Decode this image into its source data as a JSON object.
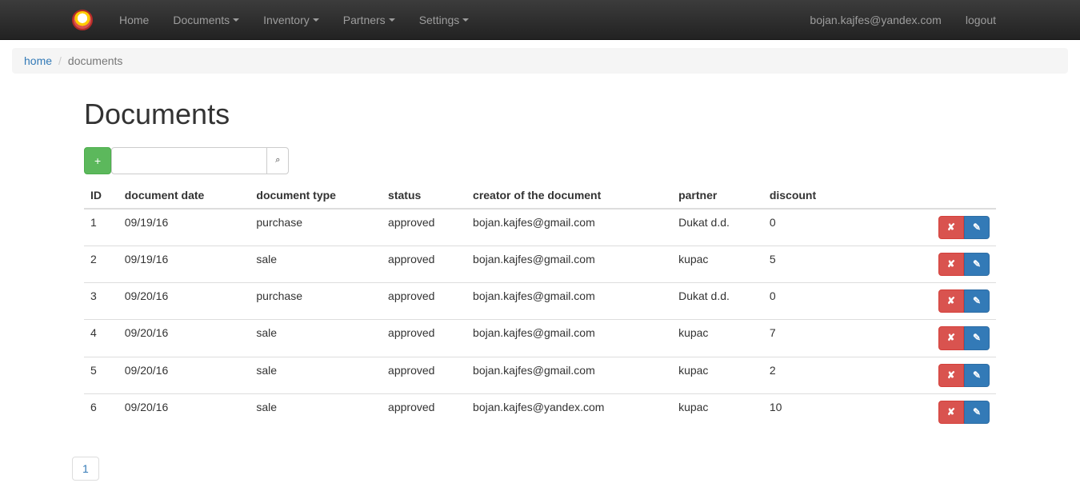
{
  "nav": {
    "home": "Home",
    "documents": "Documents",
    "inventory": "Inventory",
    "partners": "Partners",
    "settings": "Settings",
    "user_email": "bojan.kajfes@yandex.com",
    "logout": "logout"
  },
  "breadcrumb": {
    "home": "home",
    "current": "documents"
  },
  "page": {
    "title": "Documents",
    "add_label": "+",
    "search_value": ""
  },
  "table": {
    "headers": {
      "id": "ID",
      "date": "document date",
      "type": "document type",
      "status": "status",
      "creator": "creator of the document",
      "partner": "partner",
      "discount": "discount"
    },
    "rows": [
      {
        "id": "1",
        "date": "09/19/16",
        "type": "purchase",
        "status": "approved",
        "creator": "bojan.kajfes@gmail.com",
        "partner": "Dukat d.d.",
        "discount": "0"
      },
      {
        "id": "2",
        "date": "09/19/16",
        "type": "sale",
        "status": "approved",
        "creator": "bojan.kajfes@gmail.com",
        "partner": "kupac",
        "discount": "5"
      },
      {
        "id": "3",
        "date": "09/20/16",
        "type": "purchase",
        "status": "approved",
        "creator": "bojan.kajfes@gmail.com",
        "partner": "Dukat d.d.",
        "discount": "0"
      },
      {
        "id": "4",
        "date": "09/20/16",
        "type": "sale",
        "status": "approved",
        "creator": "bojan.kajfes@gmail.com",
        "partner": "kupac",
        "discount": "7"
      },
      {
        "id": "5",
        "date": "09/20/16",
        "type": "sale",
        "status": "approved",
        "creator": "bojan.kajfes@gmail.com",
        "partner": "kupac",
        "discount": "2"
      },
      {
        "id": "6",
        "date": "09/20/16",
        "type": "sale",
        "status": "approved",
        "creator": "bojan.kajfes@yandex.com",
        "partner": "kupac",
        "discount": "10"
      }
    ]
  },
  "pagination": {
    "pages": [
      "1"
    ]
  }
}
